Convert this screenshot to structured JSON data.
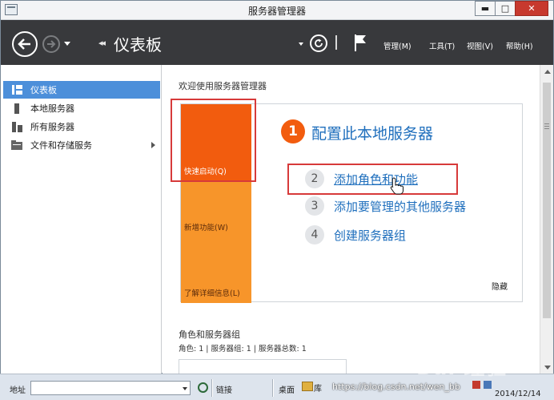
{
  "window": {
    "title": "服务器管理器",
    "controls": {
      "minimize": "▬",
      "maximize": "□",
      "close": "✕"
    }
  },
  "navbar": {
    "crumb_arrows": "◂◂",
    "title": "仪表板",
    "menus": [
      {
        "label": "管理(M)"
      },
      {
        "label": "工具(T)"
      },
      {
        "label": "视图(V)"
      },
      {
        "label": "帮助(H)"
      }
    ]
  },
  "sidebar": {
    "items": [
      {
        "label": "仪表板",
        "icon": "dashboard-icon",
        "active": true
      },
      {
        "label": "本地服务器",
        "icon": "server-icon"
      },
      {
        "label": "所有服务器",
        "icon": "servers-icon"
      },
      {
        "label": "文件和存储服务",
        "icon": "file-storage-icon",
        "has_arrow": true
      }
    ]
  },
  "main": {
    "welcome": "欢迎使用服务器管理器",
    "tiles": {
      "quick_start": "快速启动(Q)",
      "whats_new": "新增功能(W)",
      "learn_more": "了解详细信息(L)"
    },
    "steps": [
      {
        "num": "1",
        "label": "配置此本地服务器"
      },
      {
        "num": "2",
        "label": "添加角色和功能"
      },
      {
        "num": "3",
        "label": "添加要管理的其他服务器"
      },
      {
        "num": "4",
        "label": "创建服务器组"
      }
    ],
    "hide_label": "隐藏",
    "roles": {
      "title": "角色和服务器组",
      "summary": "角色: 1 | 服务器组: 1 | 服务器总数: 1"
    }
  },
  "taskbar": {
    "address_label": "地址",
    "links_label": "链接",
    "desktop_label": "桌面",
    "library_label": "库",
    "url_text": "https://blog.csdn.net/wen_bb",
    "date": "2014/12/14"
  },
  "watermark": "Bai 经验",
  "colors": {
    "accent_orange": "#f25c0e",
    "tile_orange": "#f7952a",
    "link_blue": "#1f6fbd",
    "selection_blue": "#4c8fda",
    "highlight_red": "#d73a3a",
    "navbar_dark": "#38393c"
  }
}
